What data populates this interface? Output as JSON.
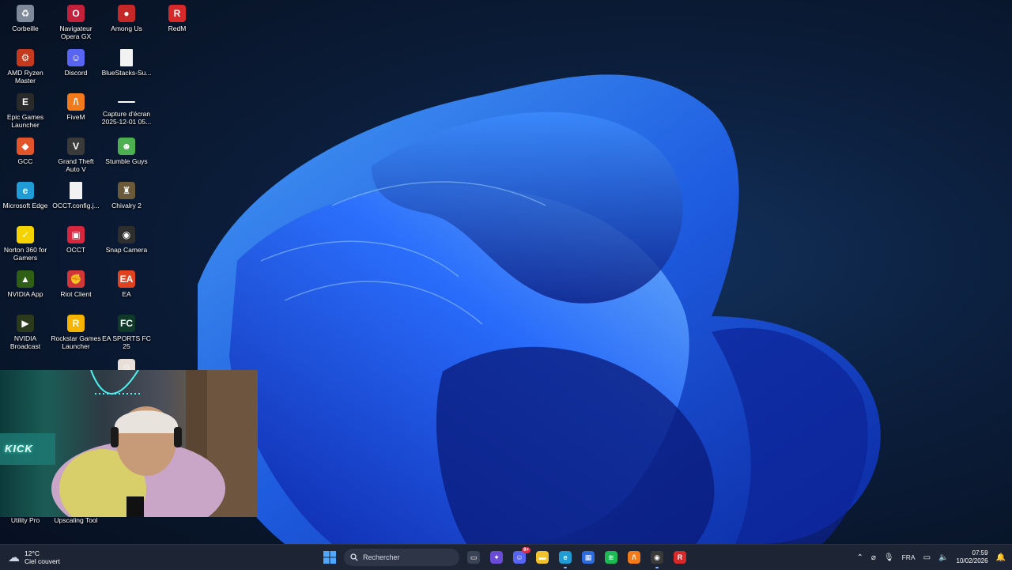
{
  "desktop": {
    "icons": [
      {
        "label": "Corbeille",
        "icon": "recycle-bin-icon",
        "color": "#7e8a9a",
        "glyph": "♻"
      },
      {
        "label": "Navigateur Opera GX",
        "icon": "opera-gx-icon",
        "color": "#c2203b",
        "glyph": "O"
      },
      {
        "label": "Among Us",
        "icon": "among-us-icon",
        "color": "#c62828",
        "glyph": "●"
      },
      {
        "label": "RedM",
        "icon": "redm-icon",
        "color": "#d62a2a",
        "glyph": "R"
      },
      {
        "label": "AMD Ryzen Master",
        "icon": "amd-ryzen-master-icon",
        "color": "#c43a1e",
        "glyph": "⚙"
      },
      {
        "label": "Discord",
        "icon": "discord-icon",
        "color": "#5865f2",
        "glyph": "☺"
      },
      {
        "label": "BlueStacks-Su...",
        "icon": "file-icon",
        "color": "#f2f2f2",
        "glyph": ""
      },
      {
        "label": "Epic Games Launcher",
        "icon": "epic-games-icon",
        "color": "#2a2a2a",
        "glyph": "E"
      },
      {
        "label": "FiveM",
        "icon": "fivem-icon",
        "color": "#f27a1a",
        "glyph": "/\\"
      },
      {
        "label": "Capture d'écran 2025-12-01 05...",
        "icon": "screenshot-file-icon",
        "color": "#ffffff",
        "glyph": ""
      },
      {
        "label": "GCC",
        "icon": "gcc-icon",
        "color": "#e2552a",
        "glyph": "◆"
      },
      {
        "label": "Grand Theft Auto V",
        "icon": "gta-v-icon",
        "color": "#3a3a3a",
        "glyph": "V"
      },
      {
        "label": "Stumble Guys",
        "icon": "stumble-guys-icon",
        "color": "#4caf50",
        "glyph": "☻"
      },
      {
        "label": "Microsoft Edge",
        "icon": "edge-icon",
        "color": "#1f9bd6",
        "glyph": "e"
      },
      {
        "label": "OCCT.config.j...",
        "icon": "file-icon",
        "color": "#f2f2f2",
        "glyph": ""
      },
      {
        "label": "Chivalry 2",
        "icon": "chivalry-2-icon",
        "color": "#6b5a3a",
        "glyph": "♜"
      },
      {
        "label": "Norton 360 for Gamers",
        "icon": "norton-icon",
        "color": "#f5d300",
        "glyph": "✓"
      },
      {
        "label": "OCCT",
        "icon": "occt-icon",
        "color": "#d7263d",
        "glyph": "▣"
      },
      {
        "label": "Snap Camera",
        "icon": "snap-camera-icon",
        "color": "#2e2e2e",
        "glyph": "◉"
      },
      {
        "label": "NVIDIA App",
        "icon": "nvidia-app-icon",
        "color": "#2f5f14",
        "glyph": "▲"
      },
      {
        "label": "Riot Client",
        "icon": "riot-client-icon",
        "color": "#d13639",
        "glyph": "✊"
      },
      {
        "label": "EA",
        "icon": "ea-icon",
        "color": "#e0411f",
        "glyph": "EA"
      },
      {
        "label": "NVIDIA Broadcast",
        "icon": "nvidia-broadcast-icon",
        "color": "#2a3a1a",
        "glyph": "▶"
      },
      {
        "label": "Rockstar Games Launcher",
        "icon": "rockstar-icon",
        "color": "#f4b400",
        "glyph": "R"
      },
      {
        "label": "EA SPORTS FC 25",
        "icon": "ea-fc-25-icon",
        "color": "#0f3a2a",
        "glyph": "FC"
      },
      {
        "label": "Utility Pro",
        "icon": "utility-pro-icon",
        "color": "#3a4a5a",
        "glyph": "⚙"
      },
      {
        "label": "Upscaling Tool",
        "icon": "upscaling-tool-icon",
        "color": "#b0183a",
        "glyph": "✕"
      },
      {
        "label": "",
        "icon": "game-icon",
        "color": "#e8e0d8",
        "glyph": "☺"
      }
    ]
  },
  "webcam": {
    "sign_text": "KICK"
  },
  "taskbar": {
    "weather": {
      "temp": "12°C",
      "desc": "Ciel couvert",
      "icon": "cloud-sun-icon"
    },
    "search_placeholder": "Rechercher",
    "apps": [
      {
        "name": "task-view-button",
        "icon": "task-view-icon",
        "color": "#3a4356",
        "glyph": "▭"
      },
      {
        "name": "copilot-button",
        "icon": "copilot-icon",
        "color": "#6a4bd8",
        "glyph": "✦"
      },
      {
        "name": "discord-taskbar-button",
        "icon": "discord-icon",
        "color": "#5865f2",
        "glyph": "☺",
        "badge": "9+"
      },
      {
        "name": "file-explorer-button",
        "icon": "folder-icon",
        "color": "#f2c12e",
        "glyph": "▬"
      },
      {
        "name": "edge-taskbar-button",
        "icon": "edge-icon",
        "color": "#1f9bd6",
        "glyph": "e",
        "active": true
      },
      {
        "name": "store-button",
        "icon": "store-icon",
        "color": "#2d6be0",
        "glyph": "▦"
      },
      {
        "name": "spotify-button",
        "icon": "spotify-icon",
        "color": "#1db954",
        "glyph": "≋"
      },
      {
        "name": "fivem-taskbar-button",
        "icon": "fivem-icon",
        "color": "#f27a1a",
        "glyph": "/\\"
      },
      {
        "name": "obs-taskbar-button",
        "icon": "obs-icon",
        "color": "#3a3a3a",
        "glyph": "◉",
        "active": true
      },
      {
        "name": "redm-taskbar-button",
        "icon": "redm-icon",
        "color": "#d62a2a",
        "glyph": "R"
      }
    ],
    "tray": {
      "language": "FRA",
      "time": "07:59",
      "date": "10/02/2026"
    }
  }
}
